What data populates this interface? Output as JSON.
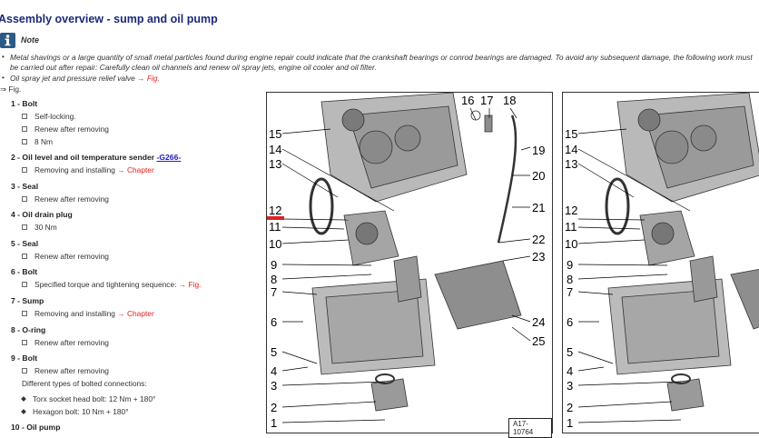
{
  "page_title": "Assembly overview - sump and oil pump",
  "note": {
    "label": "Note",
    "text": "Metal shavings or a large quantity of small metal particles found during engine repair could indicate that the crankshaft bearings or conrod bearings are damaged. To avoid any subsequent damage, the following work must be carried out after repair: Carefully clean oil channels and renew oil spray jets, engine oil cooler and oil filter."
  },
  "spray_jet": {
    "text": "Oil spray jet and pressure relief valve",
    "arrow": "→",
    "fig": "Fig."
  },
  "fig_link": "⇒ Fig.",
  "items": [
    {
      "num": "1 -",
      "name": "Bolt",
      "subs": [
        {
          "type": "sq",
          "text": "Self-locking."
        },
        {
          "type": "sq",
          "text": "Renew after removing"
        },
        {
          "type": "sq",
          "text": "8 Nm"
        }
      ]
    },
    {
      "num": "2 -",
      "name": "Oil level and oil temperature sender",
      "link": "-G266-",
      "subs": [
        {
          "type": "sq",
          "text": "Removing and installing",
          "arrow": "→",
          "ref": "Chapter"
        }
      ]
    },
    {
      "num": "3 -",
      "name": "Seal",
      "subs": [
        {
          "type": "sq",
          "text": "Renew after removing"
        }
      ]
    },
    {
      "num": "4 -",
      "name": "Oil drain plug",
      "subs": [
        {
          "type": "sq",
          "text": "30 Nm"
        }
      ]
    },
    {
      "num": "5 -",
      "name": "Seal",
      "subs": [
        {
          "type": "sq",
          "text": "Renew after removing"
        }
      ]
    },
    {
      "num": "6 -",
      "name": "Bolt",
      "subs": [
        {
          "type": "sq",
          "text": "Specified torque and tightening sequence:",
          "arrow": "→",
          "ref": "Fig."
        }
      ]
    },
    {
      "num": "7 -",
      "name": "Sump",
      "subs": [
        {
          "type": "sq",
          "text": "Removing and installing",
          "arrow": "→",
          "ref": "Chapter"
        }
      ]
    },
    {
      "num": "8 -",
      "name": "O-ring",
      "subs": [
        {
          "type": "sq",
          "text": "Renew after removing"
        }
      ]
    },
    {
      "num": "9 -",
      "name": "Bolt",
      "subs": [
        {
          "type": "sq",
          "text": "Renew after removing"
        },
        {
          "type": "plain",
          "text": "Different types of bolted connections:"
        },
        {
          "type": "dia",
          "text": "Torx socket head bolt: 12 Nm + 180°"
        },
        {
          "type": "dia",
          "text": "Hexagon bolt: 10 Nm + 180°"
        }
      ]
    },
    {
      "num": "10 -",
      "name": "Oil pump",
      "subs": []
    }
  ],
  "figure": {
    "id_label": "A17-10764",
    "callouts_left": [
      "15",
      "14",
      "13",
      "12",
      "11",
      "10",
      "9",
      "8",
      "7",
      "6",
      "5",
      "4",
      "3",
      "2",
      "1"
    ],
    "callouts_top": [
      "16",
      "17",
      "18"
    ],
    "callouts_right": [
      "19",
      "20",
      "21",
      "22",
      "23",
      "24",
      "25"
    ]
  },
  "colors": {
    "title": "#1a2a78",
    "link_red": "#e02020",
    "link_blue": "#2020c0",
    "note_icon": "#2b5a86",
    "highlight": "#e02020"
  }
}
